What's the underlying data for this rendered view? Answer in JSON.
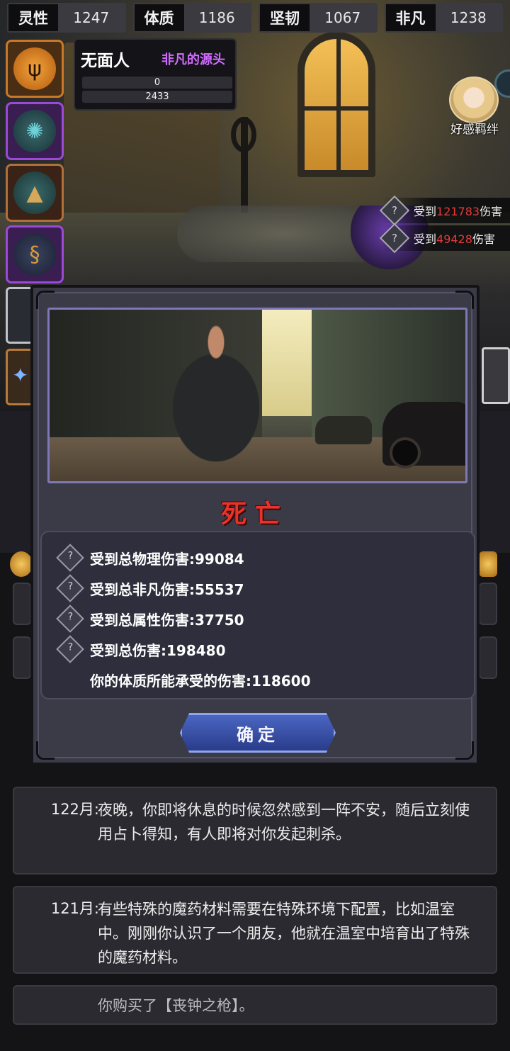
{
  "stats": [
    {
      "name": "灵性",
      "value": "1247"
    },
    {
      "name": "体质",
      "value": "1186"
    },
    {
      "name": "坚韧",
      "value": "1067"
    },
    {
      "name": "非凡",
      "value": "1238"
    }
  ],
  "enemy": {
    "name": "无面人",
    "title": "非凡的源头",
    "bar_1": "0",
    "bar_2": "2433"
  },
  "affection": {
    "label": "好感羁绊"
  },
  "damage_log": [
    {
      "prefix": "受到",
      "amount": "121783",
      "suffix": "伤害"
    },
    {
      "prefix": "受到",
      "amount": "49428",
      "suffix": "伤害"
    }
  ],
  "modal": {
    "title": "死亡",
    "summary": [
      "受到总物理伤害:99084",
      "受到总非凡伤害:55537",
      "受到总属性伤害:37750",
      "受到总伤害:198480",
      "你的体质所能承受的伤害:118600"
    ],
    "confirm_label": "确定"
  },
  "event_log": [
    {
      "month": "122月:",
      "text": "夜晚，你即将休息的时候忽然感到一阵不安，随后立刻使用占卜得知，有人即将对你发起刺杀。"
    },
    {
      "month": "121月:",
      "text": "有些特殊的魔药材料需要在特殊环境下配置，比如温室中。刚刚你认识了一个朋友，他就在温室中培育出了特殊的魔药材料。"
    },
    {
      "month": "",
      "text": "你购买了【丧钟之枪】。"
    }
  ],
  "colors": {
    "damage_number": "#e53a3a",
    "enemy_title": "#d26bff",
    "death_title": "#e8322a",
    "confirm_button": "#3a52a8"
  },
  "icons": {
    "skill_1": "trident-icon",
    "skill_2": "web-icon",
    "skill_3": "umbrella-icon",
    "skill_4": "serpent-icon",
    "damage": "diamond-question-icon"
  }
}
